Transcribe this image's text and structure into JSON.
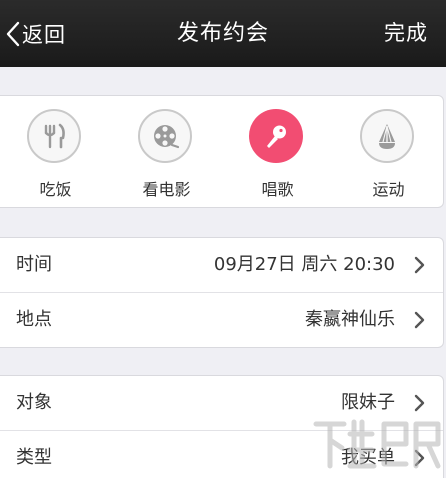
{
  "navbar": {
    "back_label": "返回",
    "title": "发布约会",
    "done_label": "完成"
  },
  "categories": [
    {
      "label": "吃饭",
      "icon": "fork-knife-icon",
      "selected": false
    },
    {
      "label": "看电影",
      "icon": "film-reel-icon",
      "selected": false
    },
    {
      "label": "唱歌",
      "icon": "microphone-icon",
      "selected": true
    },
    {
      "label": "运动",
      "icon": "shuttlecock-icon",
      "selected": false
    }
  ],
  "details": {
    "time_label": "时间",
    "time_value": "09月27日 周六 20:30",
    "place_label": "地点",
    "place_value": "秦嬴神仙乐"
  },
  "options": {
    "target_label": "对象",
    "target_value": "限妹子",
    "type_label": "类型",
    "type_value": "我买单"
  },
  "colors": {
    "navbar": "#1f1f1f",
    "accent": "#f24d72",
    "background": "#efeff4"
  },
  "icons": {
    "back": "chevron-left-icon",
    "row_arrow": "chevron-right-icon"
  }
}
